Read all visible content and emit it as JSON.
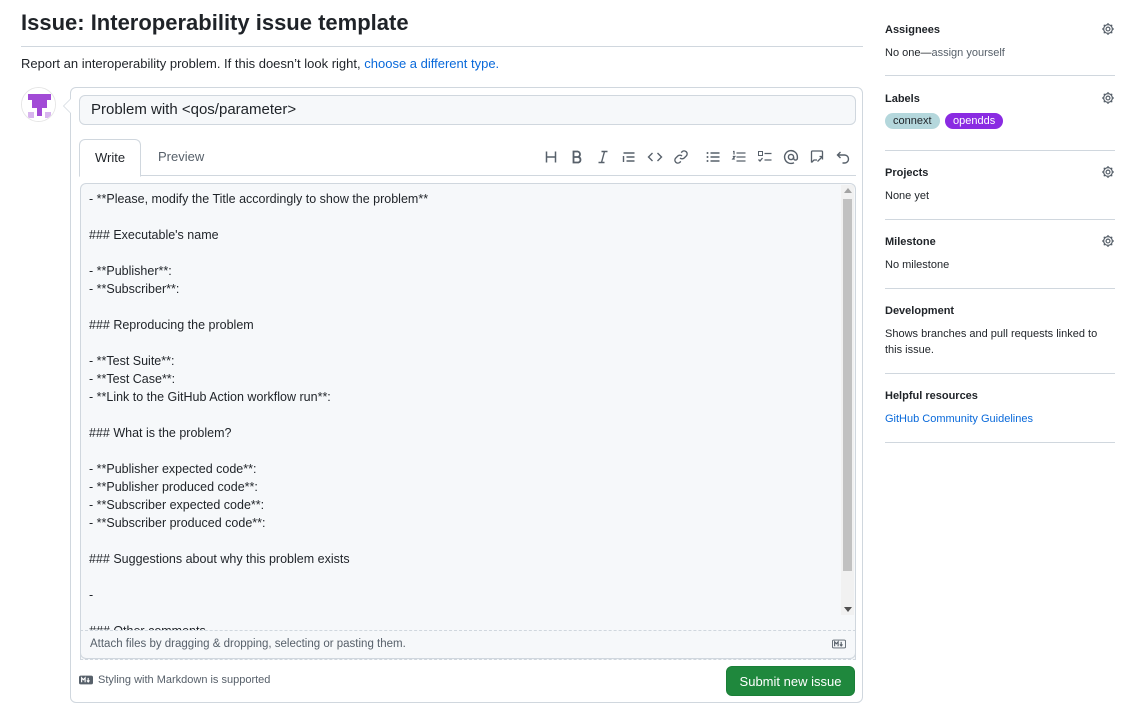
{
  "page": {
    "title": "Issue: Interoperability issue template",
    "intro_text": "Report an interoperability problem. If this doesn’t look right,",
    "intro_link": "choose a different type."
  },
  "form": {
    "title_value": "Problem with <qos/parameter>",
    "tabs": [
      {
        "label": "Write",
        "active": true
      },
      {
        "label": "Preview",
        "active": false
      }
    ],
    "toolbar_icons": [
      "heading-icon",
      "bold-icon",
      "italic-icon",
      "quote-icon",
      "code-icon",
      "link-icon",
      "unordered-list-icon",
      "ordered-list-icon",
      "task-list-icon",
      "mention-icon",
      "reference-icon",
      "undo-icon"
    ],
    "body_lines": [
      "- **Please, modify the Title accordingly to show the problem**",
      "",
      "### Executable's name",
      "",
      "- **Publisher**:",
      "- **Subscriber**:",
      "",
      "### Reproducing the problem",
      "",
      "- **Test Suite**:",
      "- **Test Case**:",
      "- **Link to the GitHub Action workflow run**:",
      "",
      "### What is the problem?",
      "",
      "- **Publisher expected code**:",
      "- **Publisher produced code**:",
      "- **Subscriber expected code**:",
      "- **Subscriber produced code**:",
      "",
      "### Suggestions about why this problem exists",
      "",
      "-",
      "",
      "### Other comments"
    ],
    "attach_text": "Attach files by dragging & dropping, selecting or pasting them.",
    "markdown_note": "Styling with Markdown is supported",
    "submit_label": "Submit new issue"
  },
  "sidebar": {
    "assignees": {
      "heading": "Assignees",
      "value": "No one—",
      "link": "assign yourself"
    },
    "labels": {
      "heading": "Labels",
      "items": [
        {
          "name": "connext",
          "bg": "#b4d7dc",
          "fg": "#1f2328"
        },
        {
          "name": "opendds",
          "bg": "#8a2be2",
          "fg": "#ffffff"
        }
      ]
    },
    "projects": {
      "heading": "Projects",
      "value": "None yet"
    },
    "milestone": {
      "heading": "Milestone",
      "value": "No milestone"
    },
    "development": {
      "heading": "Development",
      "value": "Shows branches and pull requests linked to this issue."
    },
    "helpful": {
      "heading": "Helpful resources",
      "link": "GitHub Community Guidelines"
    }
  },
  "colors": {
    "accent_link": "#0969da",
    "submit_green": "#1f883d",
    "avatar_purple": "#a24bd6"
  }
}
